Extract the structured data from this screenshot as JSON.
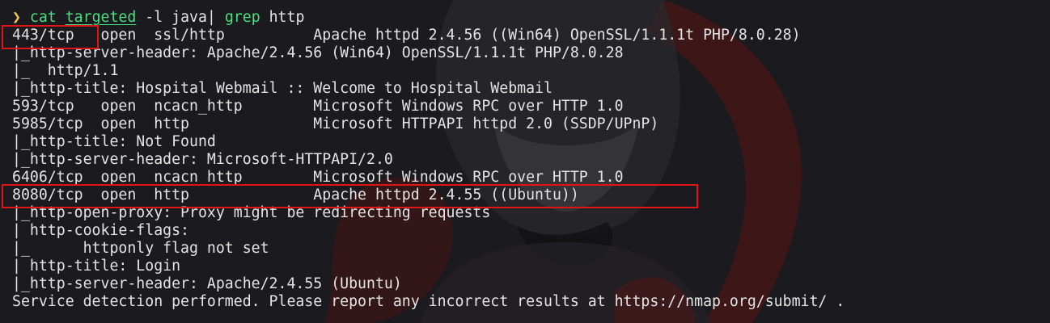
{
  "command": {
    "prompt_symbol": "❯",
    "cmd": "cat",
    "arg_file": "targeted",
    "arg_flag": "-l java|",
    "pipe_cmd": "grep",
    "pipe_arg": "http"
  },
  "output_lines": [
    "443/tcp   open  ssl/http          Apache httpd 2.4.56 ((Win64) OpenSSL/1.1.1t PHP/8.0.28)",
    "|_http-server-header: Apache/2.4.56 (Win64) OpenSSL/1.1.1t PHP/8.0.28",
    "|_  http/1.1",
    "|_http-title: Hospital Webmail :: Welcome to Hospital Webmail",
    "593/tcp   open  ncacn_http        Microsoft Windows RPC over HTTP 1.0",
    "5985/tcp  open  http              Microsoft HTTPAPI httpd 2.0 (SSDP/UPnP)",
    "|_http-title: Not Found",
    "|_http-server-header: Microsoft-HTTPAPI/2.0",
    "6406/tcp  open  ncacn_http        Microsoft Windows RPC over HTTP 1.0",
    "8080/tcp  open  http              Apache httpd 2.4.55 ((Ubuntu))",
    "|_http-open-proxy: Proxy might be redirecting requests",
    "| http-cookie-flags:",
    "|_      httponly flag not set",
    "| http-title: Login",
    "|_http-server-header: Apache/2.4.55 (Ubuntu)",
    "Service detection performed. Please report any incorrect results at https://nmap.org/submit/ ."
  ],
  "colors": {
    "background": "#1b1a1e",
    "text": "#e4e4e4",
    "prompt": "#f2c94c",
    "command": "#4ade80",
    "highlight_box": "#e01515",
    "wallpaper_red": "#7a1616"
  },
  "highlights": [
    "port-443-highlight",
    "port-8080-row-highlight"
  ]
}
